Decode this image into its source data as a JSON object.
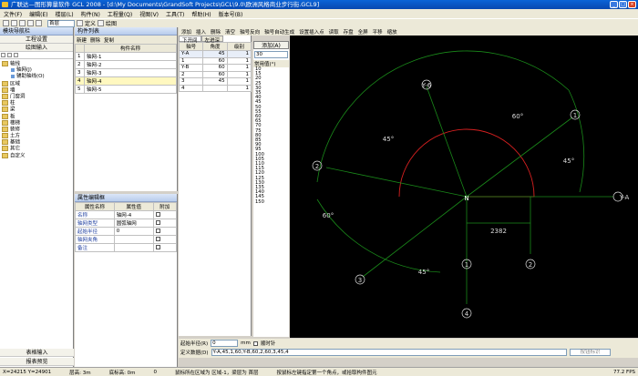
{
  "title": "广联达—图形算量软件 GCL 2008 - [d:\\My Documents\\GrandSoft Projects\\GCL\\9.0\\欧洲风格商业步行街.GCL9]",
  "menu": [
    "文件(F)",
    "编辑(E)",
    "楼层(L)",
    "构件(N)",
    "工程量(Q)",
    "视图(V)",
    "工具(T)",
    "帮助(H)",
    "版本号(B)"
  ],
  "floor_select": "首层",
  "toolbar_labels": [
    "定义",
    "绘图"
  ],
  "left_panel": {
    "title": "模块导航栏",
    "btn1": "工程设置",
    "btn2": "绘图输入",
    "tree": [
      {
        "label": "轴线",
        "lvl": 0,
        "t": "fold"
      },
      {
        "label": "轴网(J)",
        "lvl": 1,
        "t": "leaf"
      },
      {
        "label": "辅助轴线(O)",
        "lvl": 1,
        "t": "leaf"
      },
      {
        "label": "区域",
        "lvl": 0,
        "t": "fold"
      },
      {
        "label": "墙",
        "lvl": 0,
        "t": "fold"
      },
      {
        "label": "门窗洞",
        "lvl": 0,
        "t": "fold"
      },
      {
        "label": "柱",
        "lvl": 0,
        "t": "fold"
      },
      {
        "label": "梁",
        "lvl": 0,
        "t": "fold"
      },
      {
        "label": "板",
        "lvl": 0,
        "t": "fold"
      },
      {
        "label": "楼梯",
        "lvl": 0,
        "t": "fold"
      },
      {
        "label": "装修",
        "lvl": 0,
        "t": "fold"
      },
      {
        "label": "土方",
        "lvl": 0,
        "t": "fold"
      },
      {
        "label": "基础",
        "lvl": 0,
        "t": "fold"
      },
      {
        "label": "其它",
        "lvl": 0,
        "t": "fold"
      },
      {
        "label": "自定义",
        "lvl": 0,
        "t": "fold"
      }
    ],
    "bottom1": "表格输入",
    "bottom2": "报表预览"
  },
  "component_list": {
    "title": "构件列表",
    "new_btn": "新建",
    "delete_btn": "删除",
    "copy_btn": "复制",
    "header": "构件名称",
    "rows": [
      {
        "idx": "1",
        "name": "轴网-1"
      },
      {
        "idx": "2",
        "name": "轴网-2"
      },
      {
        "idx": "3",
        "name": "轴网-3"
      },
      {
        "idx": "4",
        "name": "轴网-4"
      },
      {
        "idx": "5",
        "name": "轴网-5"
      }
    ]
  },
  "property_editor": {
    "title": "属性编辑框",
    "headers": [
      "属性名称",
      "属性值",
      "附加"
    ],
    "rows": [
      {
        "name": "名称",
        "value": "轴网-4"
      },
      {
        "name": "轴网类型",
        "value": "圆弧轴网"
      },
      {
        "name": "起始半径",
        "value": "0"
      },
      {
        "name": "轴网夹角",
        "value": ""
      },
      {
        "name": "备注",
        "value": ""
      }
    ]
  },
  "drawing_toolbar": [
    "添加",
    "插入",
    "删除",
    "清空",
    "轴号反向",
    "轴号自动生成",
    "设置插入点",
    "读取",
    "存盘",
    "全屏",
    "平移",
    "缩放"
  ],
  "axis_tabs": [
    "下开间",
    "左进深"
  ],
  "axis_table": {
    "headers": [
      "轴号",
      "角度",
      "级别"
    ],
    "rows": [
      {
        "a": "Y-A",
        "b": "45",
        "c": "1"
      },
      {
        "a": "1",
        "b": "60",
        "c": "1"
      },
      {
        "a": "Y-B",
        "b": "60",
        "c": "1"
      },
      {
        "a": "2",
        "b": "60",
        "c": "1"
      },
      {
        "a": "3",
        "b": "45",
        "c": "1"
      },
      {
        "a": "4",
        "b": "",
        "c": "1"
      }
    ]
  },
  "add_panel": {
    "add_label": "添加(A)",
    "input_value": "30",
    "common_label": "常用值(°)",
    "values": [
      "10",
      "15",
      "20",
      "25",
      "30",
      "35",
      "40",
      "45",
      "50",
      "55",
      "60",
      "65",
      "70",
      "75",
      "80",
      "85",
      "90",
      "95",
      "100",
      "105",
      "110",
      "115",
      "120",
      "125",
      "130",
      "135",
      "140",
      "145",
      "150"
    ]
  },
  "canvas": {
    "labels": {
      "ya": "Y-A",
      "yb": "Y-6",
      "n": "N",
      "dim": "2382",
      "ang1": "60°",
      "ang2": "45°",
      "ang3": "45°",
      "ang4": "60°",
      "ang5": "45°",
      "c1": "1",
      "c2": "2",
      "c3": "3",
      "c4": "4",
      "c5": "1",
      "c6": "2"
    }
  },
  "bottom": {
    "radius_label": "起始半径(R)",
    "radius_value": "0",
    "radius_unit": "mm",
    "chk_label": "顺时针",
    "def_label": "定义数据(D)",
    "def_value": "Y-A,45,1,60,Y-B,60,2,60,3,45,4",
    "calc_btn": "按钮标识"
  },
  "status": {
    "coords": "X=24215 Y=24901",
    "floor_h": "层高: 3m",
    "base_h": "底标高: 0m",
    "zero": "0",
    "hint1": "鼠标所在区域为 区域-1，梁层为 首层",
    "hint2": "按鼠标左键指定第一个角点，或拾取构件图元",
    "fps": "77.2 FPS"
  }
}
